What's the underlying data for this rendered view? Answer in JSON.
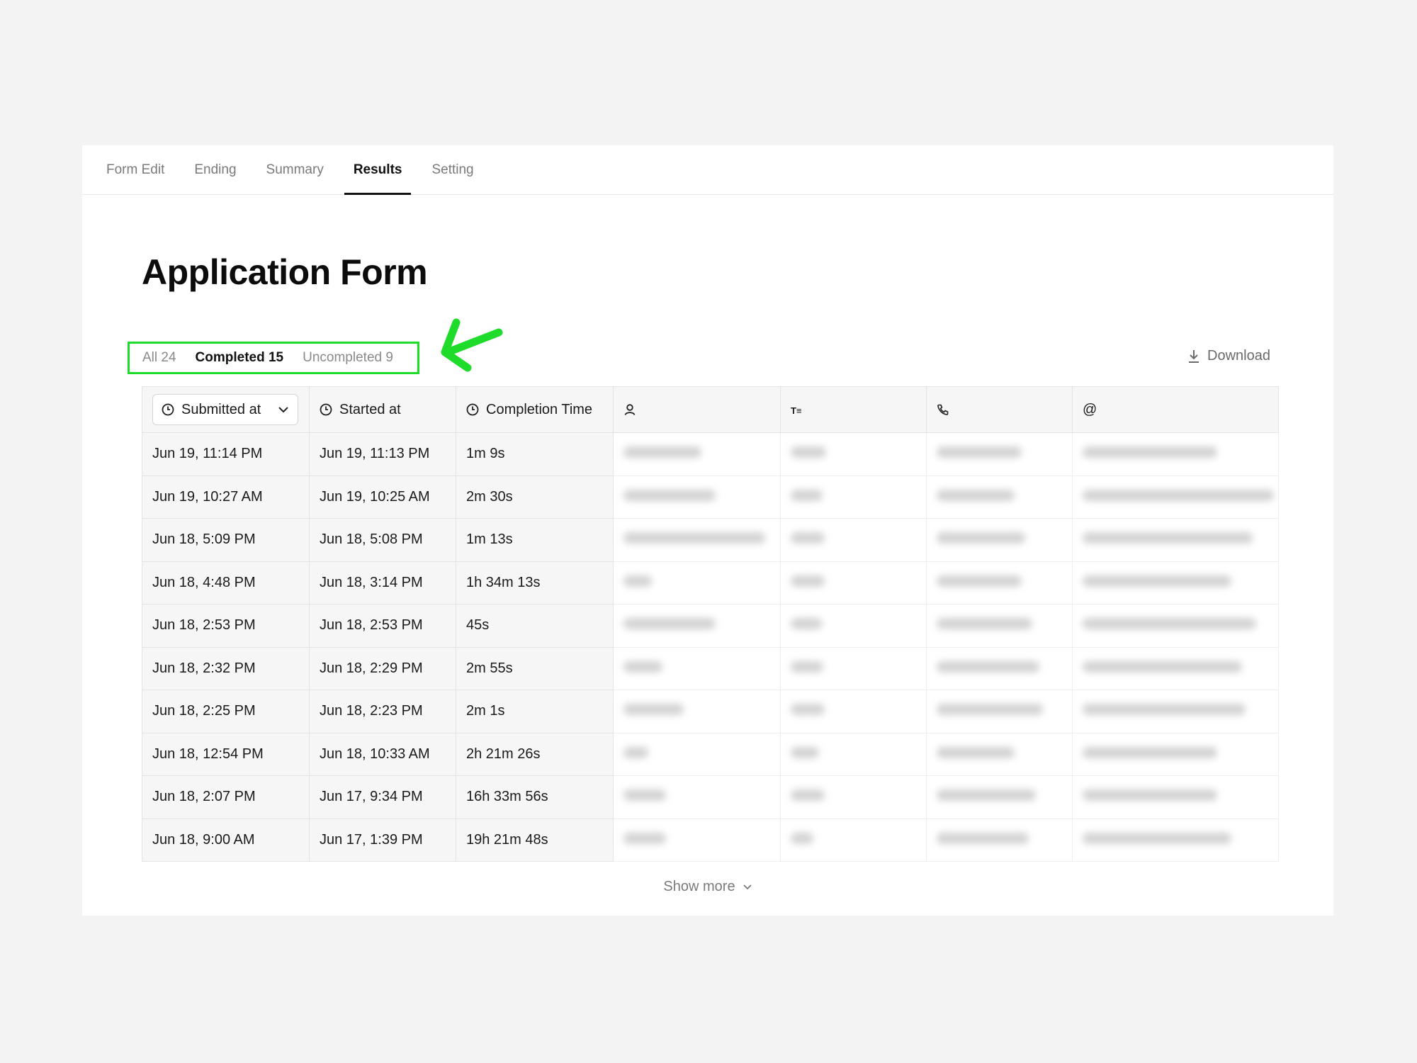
{
  "tabs": [
    {
      "label": "Form Edit"
    },
    {
      "label": "Ending"
    },
    {
      "label": "Summary"
    },
    {
      "label": "Results",
      "active": true
    },
    {
      "label": "Setting"
    }
  ],
  "page_title": "Application Form",
  "filters": {
    "all": "All 24",
    "completed": "Completed 15",
    "uncompleted": "Uncompleted 9"
  },
  "download_label": "Download",
  "columns": {
    "submitted": "Submitted at",
    "started": "Started at",
    "completion": "Completion Time",
    "text_icon_label": "T≡",
    "email_icon_label": "@"
  },
  "rows": [
    {
      "submitted": "Jun 19, 11:14 PM",
      "started": "Jun 19, 11:13 PM",
      "completion": "1m 9s"
    },
    {
      "submitted": "Jun 19, 10:27 AM",
      "started": "Jun 19, 10:25 AM",
      "completion": "2m 30s"
    },
    {
      "submitted": "Jun 18, 5:09 PM",
      "started": "Jun 18, 5:08 PM",
      "completion": "1m 13s"
    },
    {
      "submitted": "Jun 18, 4:48 PM",
      "started": "Jun 18, 3:14 PM",
      "completion": "1h 34m 13s"
    },
    {
      "submitted": "Jun 18, 2:53 PM",
      "started": "Jun 18, 2:53 PM",
      "completion": "45s"
    },
    {
      "submitted": "Jun 18, 2:32 PM",
      "started": "Jun 18, 2:29 PM",
      "completion": "2m 55s"
    },
    {
      "submitted": "Jun 18, 2:25 PM",
      "started": "Jun 18, 2:23 PM",
      "completion": "2m 1s"
    },
    {
      "submitted": "Jun 18, 12:54 PM",
      "started": "Jun 18, 10:33 AM",
      "completion": "2h 21m 26s"
    },
    {
      "submitted": "Jun 18, 2:07 PM",
      "started": "Jun 17, 9:34 PM",
      "completion": "16h 33m 56s"
    },
    {
      "submitted": "Jun 18, 9:00 AM",
      "started": "Jun 17, 1:39 PM",
      "completion": "19h 21m 48s"
    }
  ],
  "show_more": "Show more",
  "colors": {
    "annotation": "#1fdc2a",
    "header_bg": "#f6f6f6",
    "border": "#e4e4e4"
  }
}
